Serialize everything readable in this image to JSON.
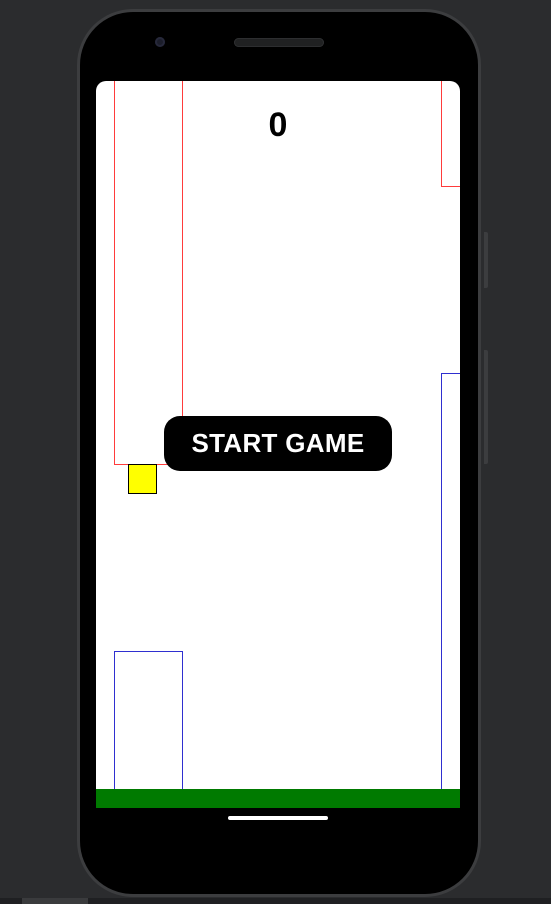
{
  "game": {
    "score": "0",
    "start_button_label": "START GAME"
  },
  "colors": {
    "top_pipe_outline": "#ff3b3b",
    "bottom_pipe_outline": "#2f2fd0",
    "bird_fill": "#ffff00",
    "ground_fill": "#007a00",
    "screen_background": "#ffffff",
    "button_fill": "#000000",
    "button_text": "#ffffff"
  }
}
